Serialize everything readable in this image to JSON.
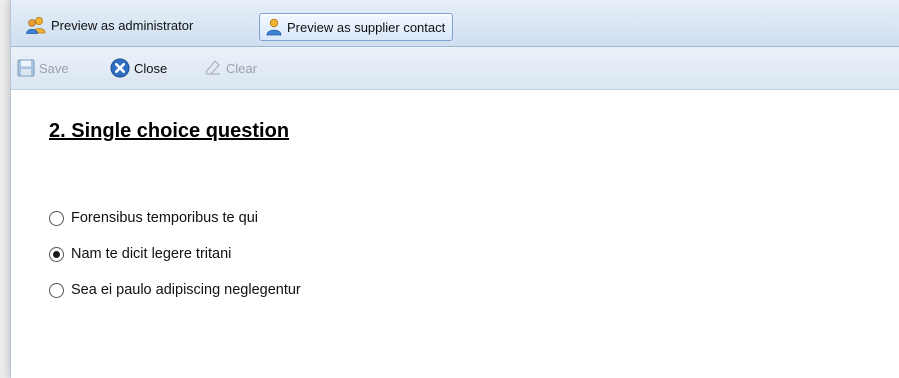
{
  "tabs": [
    {
      "label": "Preview as administrator",
      "icon": "users-icon",
      "active": false
    },
    {
      "label": "Preview as supplier contact",
      "icon": "user-icon",
      "active": true
    }
  ],
  "toolbar": {
    "save_label": "Save",
    "close_label": "Close",
    "clear_label": "Clear"
  },
  "question": {
    "title": "2. Single choice question",
    "options": [
      {
        "label": "Forensibus temporibus te qui",
        "selected": false
      },
      {
        "label": "Nam te dicit legere tritani",
        "selected": true
      },
      {
        "label": "Sea ei paulo adipiscing neglegentur",
        "selected": false
      }
    ]
  },
  "colors": {
    "accent": "#2f6fc1",
    "tabbar": "#cfdff0",
    "disabled_text": "#9aa3ad"
  }
}
